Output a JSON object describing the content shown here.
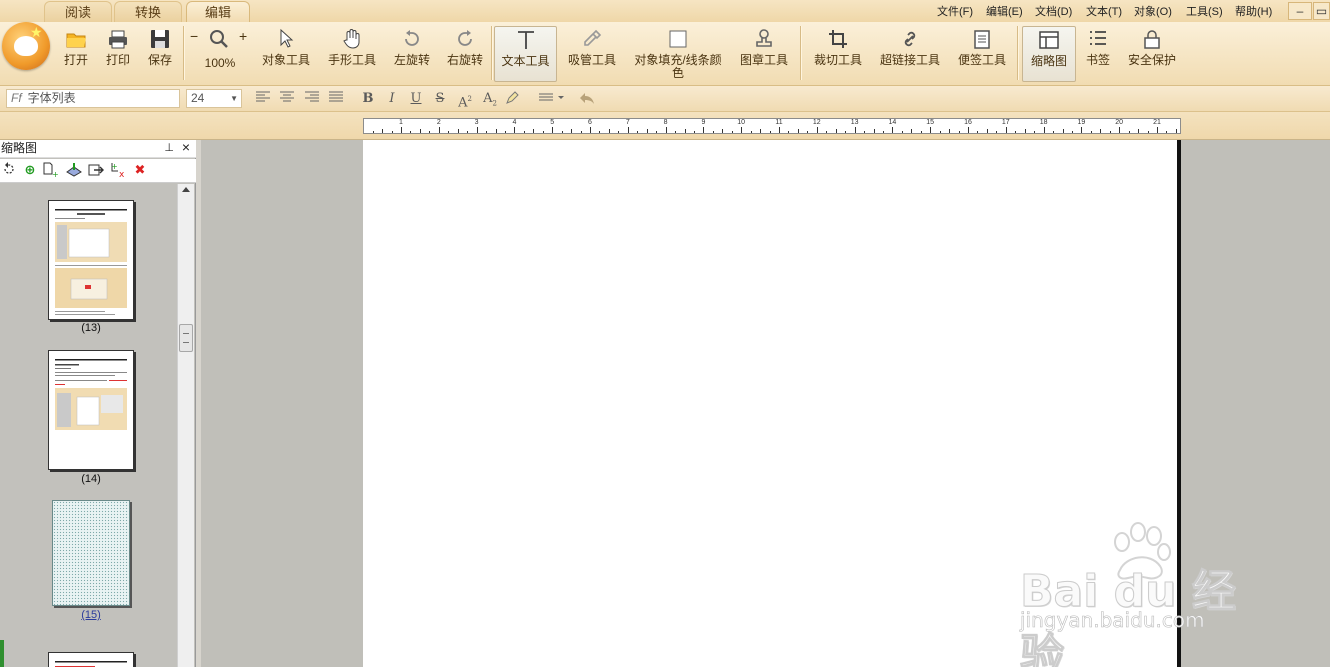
{
  "tabs": [
    {
      "label": "阅读",
      "active": false
    },
    {
      "label": "转换",
      "active": false
    },
    {
      "label": "编辑",
      "active": true
    }
  ],
  "menu": [
    "文件(F)",
    "编辑(E)",
    "文档(D)",
    "文本(T)",
    "对象(O)",
    "工具(S)",
    "帮助(H)"
  ],
  "window": {
    "minimize": "–",
    "maximize": "▭"
  },
  "ribbon": {
    "open": "打开",
    "print": "打印",
    "save": "保存",
    "zoom_minus": "−",
    "zoom_plus": "+",
    "zoom": "100%",
    "object_tool": "对象工具",
    "hand_tool": "手形工具",
    "rotate_left": "左旋转",
    "rotate_right": "右旋转",
    "text_tool": "文本工具",
    "eyedropper": "吸管工具",
    "fill_color_1": "对象填充/线条颜",
    "fill_color_2": "色",
    "stamp_tool": "图章工具",
    "crop_tool": "裁切工具",
    "link_tool": "超链接工具",
    "note_tool": "便签工具",
    "thumbnail": "缩略图",
    "bookmark": "书签",
    "security": "安全保护"
  },
  "format": {
    "font_placeholder": "字体列表",
    "font_size": "24",
    "bold": "B",
    "italic": "I",
    "underline": "U",
    "strike": "S",
    "superscript": "A",
    "subscript": "A"
  },
  "ruler_numbers": [
    "1",
    "2",
    "3",
    "4",
    "5",
    "6",
    "7",
    "8",
    "9",
    "10",
    "11",
    "12",
    "13",
    "14",
    "15",
    "16",
    "17",
    "18",
    "19",
    "20",
    "21"
  ],
  "panel": {
    "title": "缩略图",
    "pin": "⊥",
    "close": "×"
  },
  "thumbnails": [
    {
      "label": "(13)",
      "selected": false
    },
    {
      "label": "(14)",
      "selected": false
    },
    {
      "label": "(15)",
      "selected": true
    }
  ],
  "watermark": {
    "brand": "Bai  du 经验",
    "url": "jingyan.baidu.com"
  }
}
